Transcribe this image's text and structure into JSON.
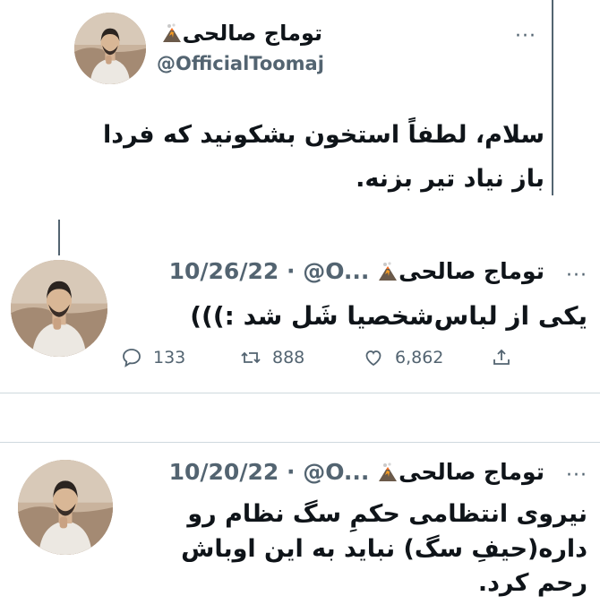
{
  "quoted_tweet": {
    "display_name": "توماج صالحی",
    "handle": "@OfficialToomaj",
    "text_lines": [
      "سلام، لطفاً استخون بشکونید که فردا",
      "باز نیاد تیر بزنه."
    ],
    "more_label": "···"
  },
  "tweet1": {
    "display_name": "توماج صالحی",
    "handle_short": "@O...",
    "separator": "·",
    "date": "10/26/22",
    "text": "یکی از لباس‌شخصیا شَل شد :)))",
    "more_label": "···",
    "replies": "133",
    "retweets": "888",
    "likes": "6,862"
  },
  "tweet2": {
    "display_name": "توماج صالحی",
    "handle_short": "@O...",
    "separator": "·",
    "date": "10/20/22",
    "text_lines": [
      "نیروی انتظامی حکمِ سگ نظام رو",
      "داره(حیفِ سگ) نباید به این اوباش",
      "رحم کرد."
    ],
    "more_label": "···"
  },
  "icons": {
    "reply": "speech-bubble-icon",
    "retweet": "retweet-icon",
    "like": "heart-icon",
    "share": "share-icon",
    "emoji": "volcano-emoji-icon"
  },
  "colors": {
    "text": "#0f1419",
    "muted": "#536471",
    "divider": "#cfd9de"
  }
}
